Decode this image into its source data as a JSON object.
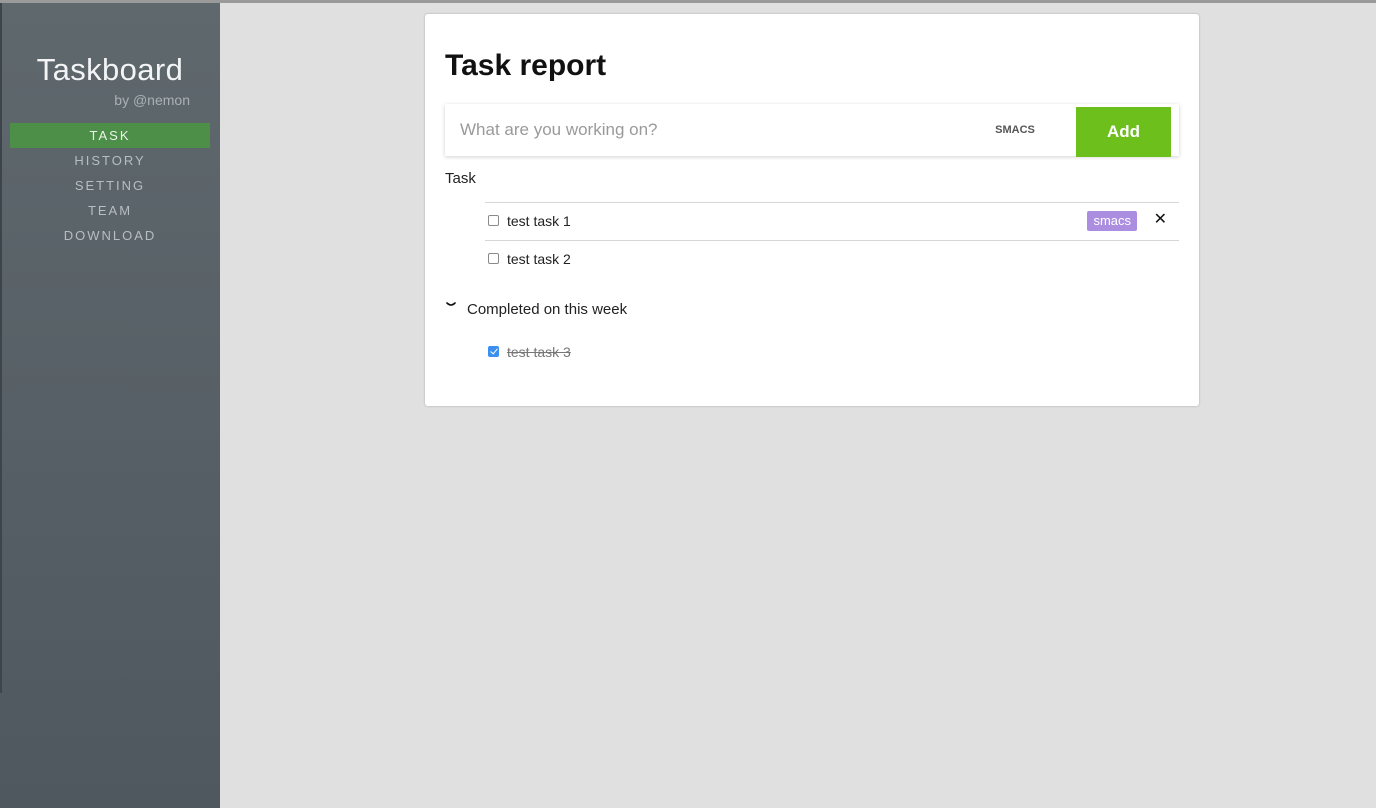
{
  "app": {
    "title": "Taskboard",
    "subtitle": "by @nemon"
  },
  "sidebar": {
    "items": [
      {
        "label": "TASK",
        "active": true
      },
      {
        "label": "HISTORY",
        "active": false
      },
      {
        "label": "SETTING",
        "active": false
      },
      {
        "label": "TEAM",
        "active": false
      },
      {
        "label": "DOWNLOAD",
        "active": false
      }
    ]
  },
  "main": {
    "title": "Task report",
    "add_bar": {
      "placeholder": "What are you working on?",
      "value": "",
      "project": "SMACS",
      "add_label": "Add"
    },
    "task_section_label": "Task",
    "tasks": [
      {
        "text": "test task 1",
        "checked": false,
        "tag": "smacs",
        "delete_icon": "close-icon"
      },
      {
        "text": "test task 2",
        "checked": false,
        "tag": null
      }
    ],
    "completed": {
      "label": "Completed on this week",
      "expanded": true,
      "icon": "chevron-down-icon",
      "tasks": [
        {
          "text": "test task 3",
          "checked": true
        }
      ]
    }
  },
  "colors": {
    "sidebar_bg": "#555e64",
    "active_nav": "#4d8f48",
    "add_button": "#6dbf1b",
    "tag_bg": "#ab8ee0",
    "checkbox_checked": "#3b8ff0",
    "page_bg": "#e0e0e0"
  }
}
